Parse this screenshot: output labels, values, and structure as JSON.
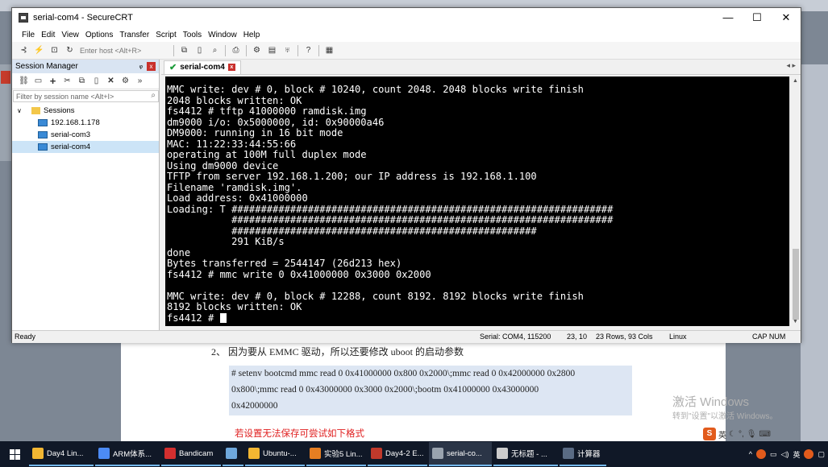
{
  "window": {
    "title": "serial-com4 - SecureCRT",
    "minimize": "—",
    "maximize": "☐",
    "close": "✕"
  },
  "menu": [
    "File",
    "Edit",
    "View",
    "Options",
    "Transfer",
    "Script",
    "Tools",
    "Window",
    "Help"
  ],
  "toolbar": {
    "host_placeholder": "Enter host <Alt+R>"
  },
  "session_manager": {
    "title": "Session Manager",
    "pin": "ᵩ",
    "close": "x",
    "filter_placeholder": "Filter by session name <Alt+I>",
    "root": "Sessions",
    "items": [
      {
        "label": "192.168.1.178",
        "selected": false
      },
      {
        "label": "serial-com3",
        "selected": false
      },
      {
        "label": "serial-com4",
        "selected": true
      }
    ]
  },
  "tab": {
    "label": "serial-com4",
    "close": "x"
  },
  "terminal": {
    "lines": [
      "MMC write: dev # 0, block # 10240, count 2048. 2048 blocks write finish",
      "2048 blocks written: OK",
      "fs4412 # tftp 41000000 ramdisk.img",
      "dm9000 i/o: 0x5000000, id: 0x90000a46",
      "DM9000: running in 16 bit mode",
      "MAC: 11:22:33:44:55:66",
      "operating at 100M full duplex mode",
      "Using dm9000 device",
      "TFTP from server 192.168.1.200; our IP address is 192.168.1.100",
      "Filename 'ramdisk.img'.",
      "Load address: 0x41000000",
      "Loading: T #################################################################",
      "           #################################################################",
      "           ####################################################",
      "           291 KiB/s",
      "done",
      "Bytes transferred = 2544147 (26d213 hex)",
      "fs4412 # mmc write 0 0x41000000 0x3000 0x2000",
      "",
      "MMC write: dev # 0, block # 12288, count 8192. 8192 blocks write finish",
      "8192 blocks written: OK"
    ],
    "prompt": "fs4412 # "
  },
  "status": {
    "ready": "Ready",
    "serial": "Serial: COM4, 115200",
    "position": "23, 10",
    "size": "23 Rows, 93 Cols",
    "os": "Linux",
    "caps": "CAP NUM"
  },
  "document": {
    "step": "2、   因为要从 EMMC 驱动，所以还要修改 uboot 的启动参数",
    "code_lines": [
      "# setenv bootcmd mmc read 0 0x41000000 0x800 0x2000\\;mmc read 0 0x42000000 0x2800",
      "0x800\\;mmc read 0 0x43000000 0x3000 0x2000\\;bootm 0x41000000 0x43000000",
      "0x42000000"
    ],
    "note": "若设置无法保存可尝试如下格式",
    "watermark": "激活 Windows",
    "watermark_sub": "转到\"设置\"以激活 Windows。"
  },
  "ime": {
    "lang": "英"
  },
  "taskbar": {
    "items": [
      {
        "label": "Day4 Lin...",
        "color": "#f2b632"
      },
      {
        "label": "ARM体系...",
        "color": "#4c8bf5"
      },
      {
        "label": "Bandicam",
        "color": "#d32f2f"
      },
      {
        "label": "",
        "color": "#6fa8dc"
      },
      {
        "label": "Ubuntu-...",
        "color": "#f2b632"
      },
      {
        "label": "实验5 Lin...",
        "color": "#e67e22"
      },
      {
        "label": "Day4-2 E...",
        "color": "#c0392b"
      },
      {
        "label": "serial-co...",
        "color": "#9aa3ae"
      },
      {
        "label": "无标题 - ...",
        "color": "#cccccc"
      },
      {
        "label": "计算器",
        "color": "#5a6b84"
      }
    ],
    "tray_lang": "英"
  }
}
